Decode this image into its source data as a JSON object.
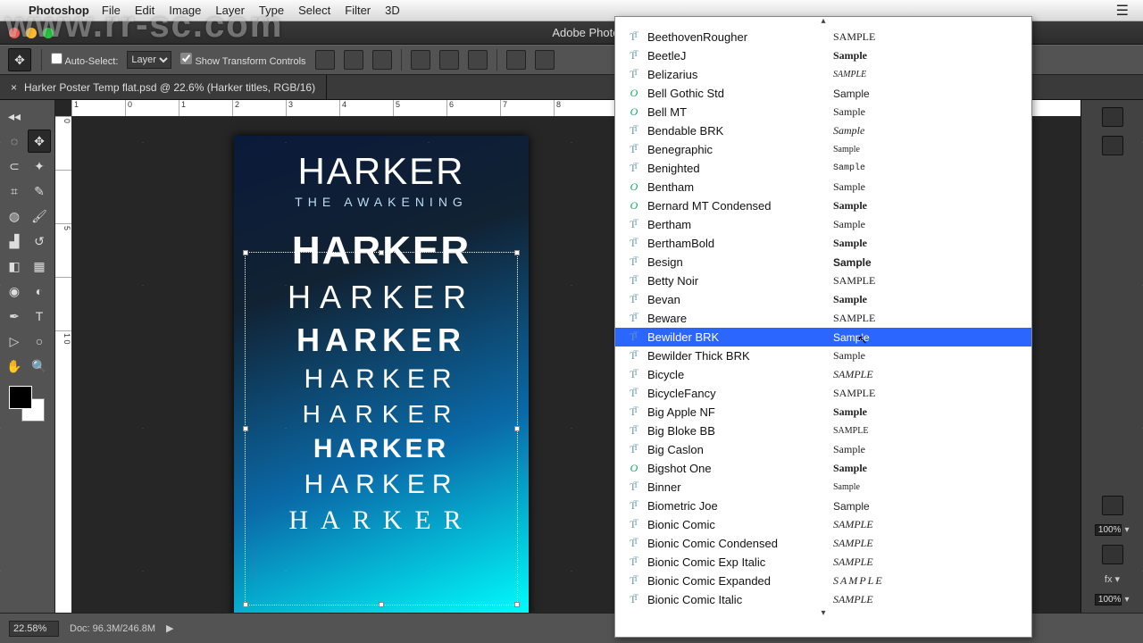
{
  "watermark": "www.rr-sc.com",
  "mac_menu": {
    "app": "Photoshop",
    "items": [
      "File",
      "Edit",
      "Image",
      "Layer",
      "Type",
      "Select",
      "Filter",
      "3D"
    ]
  },
  "window_title": "Adobe Photoshop",
  "options_bar": {
    "auto_select_label": "Auto-Select:",
    "auto_select_value": "Layer",
    "show_transform_label": "Show Transform Controls"
  },
  "doc_tab": {
    "close": "×",
    "title": "Harker Poster Temp flat.psd @ 22.6% (Harker titles, RGB/16)"
  },
  "ruler_h": [
    "1",
    "0",
    "1",
    "2",
    "3",
    "4",
    "5",
    "6",
    "7",
    "8"
  ],
  "ruler_v": [
    "0",
    "",
    "5",
    "",
    "1 0"
  ],
  "poster": {
    "title": "HARKER",
    "subtitle": "THE AWAKENING",
    "variants": [
      "HARKER",
      "HARKER",
      "HARKER",
      "HARKER",
      "HARKER",
      "HARKER",
      "HARKER",
      "HARKER"
    ]
  },
  "right_panel": {
    "opacity_val": "100%",
    "fill_val": "100%"
  },
  "status": {
    "zoom": "22.58%",
    "doc": "Doc: 96.3M/246.8M",
    "arrow": "▶"
  },
  "font_list": {
    "selected_index": 16,
    "items": [
      {
        "icon": "tt",
        "name": "BeethovenRougher",
        "sample": "SAMPLE",
        "style": "font-family:Impact"
      },
      {
        "icon": "tt",
        "name": "BeetleJ",
        "sample": "Sample",
        "style": "font-family:'Comic Sans MS';font-weight:bold"
      },
      {
        "icon": "tt",
        "name": "Belizarius",
        "sample": "SAMPLE",
        "style": "font-family:Georgia;font-style:italic;font-size:10px"
      },
      {
        "icon": "o",
        "name": "Bell Gothic Std",
        "sample": "Sample",
        "style": "font-family:Arial"
      },
      {
        "icon": "o",
        "name": "Bell MT",
        "sample": "Sample",
        "style": "font-family:'Times New Roman'"
      },
      {
        "icon": "tt",
        "name": "Bendable BRK",
        "sample": "Sample",
        "style": "font-family:cursive;font-style:italic"
      },
      {
        "icon": "tt",
        "name": "Benegraphic",
        "sample": "Sample",
        "style": "font-family:Georgia;font-size:10px"
      },
      {
        "icon": "tt",
        "name": "Benighted",
        "sample": "Sample",
        "style": "font-family:'Courier New';font-size:10px"
      },
      {
        "icon": "o",
        "name": "Bentham",
        "sample": "Sample",
        "style": "font-family:Georgia"
      },
      {
        "icon": "o",
        "name": "Bernard MT Condensed",
        "sample": "Sample",
        "style": "font-family:Impact;font-weight:bold"
      },
      {
        "icon": "tt",
        "name": "Bertham",
        "sample": "Sample",
        "style": "font-family:Georgia"
      },
      {
        "icon": "tt",
        "name": "BerthamBold",
        "sample": "Sample",
        "style": "font-family:Georgia;font-weight:bold"
      },
      {
        "icon": "tt",
        "name": "Besign",
        "sample": "Sample",
        "style": "font-family:Arial;font-weight:bold"
      },
      {
        "icon": "tt",
        "name": "Betty Noir",
        "sample": "SAMPLE",
        "style": "font-family:Impact"
      },
      {
        "icon": "tt",
        "name": "Bevan",
        "sample": "Sample",
        "style": "font-family:Arial Black;font-weight:bold"
      },
      {
        "icon": "tt",
        "name": "Beware",
        "sample": "SAMPLE",
        "style": "font-family:Impact"
      },
      {
        "icon": "tt",
        "name": "Bewilder BRK",
        "sample": "Sample",
        "style": ""
      },
      {
        "icon": "tt",
        "name": "Bewilder Thick BRK",
        "sample": "Sample",
        "style": "font-family:cursive"
      },
      {
        "icon": "tt",
        "name": "Bicycle",
        "sample": "SAMPLE",
        "style": "font-family:Impact;font-style:italic"
      },
      {
        "icon": "tt",
        "name": "BicycleFancy",
        "sample": "SAMPLE",
        "style": "font-family:Impact"
      },
      {
        "icon": "tt",
        "name": "Big Apple NF",
        "sample": "Sample",
        "style": "font-family:'Brush Script MT';font-weight:bold"
      },
      {
        "icon": "tt",
        "name": "Big Bloke BB",
        "sample": "SAMPLE",
        "style": "font-family:Impact;font-size:10px"
      },
      {
        "icon": "tt",
        "name": "Big Caslon",
        "sample": "Sample",
        "style": "font-family:Georgia"
      },
      {
        "icon": "o",
        "name": "Bigshot One",
        "sample": "Sample",
        "style": "font-family:Georgia;font-weight:bold"
      },
      {
        "icon": "tt",
        "name": "Binner",
        "sample": "Sample",
        "style": "font-family:'Times New Roman';font-size:10px"
      },
      {
        "icon": "tt",
        "name": "Biometric Joe",
        "sample": "Sample",
        "style": "font-family:Arial"
      },
      {
        "icon": "tt",
        "name": "Bionic Comic",
        "sample": "SAMPLE",
        "style": "font-family:Impact;font-style:italic"
      },
      {
        "icon": "tt",
        "name": "Bionic Comic Condensed",
        "sample": "SAMPLE",
        "style": "font-family:Impact;font-style:italic"
      },
      {
        "icon": "tt",
        "name": "Bionic Comic Exp Italic",
        "sample": "SAMPLE",
        "style": "font-family:Impact;font-style:italic"
      },
      {
        "icon": "tt",
        "name": "Bionic Comic Expanded",
        "sample": "SAMPLE",
        "style": "font-family:Impact;font-style:italic;letter-spacing:2px"
      },
      {
        "icon": "tt",
        "name": "Bionic Comic Italic",
        "sample": "SAMPLE",
        "style": "font-family:Impact;font-style:italic"
      }
    ]
  }
}
